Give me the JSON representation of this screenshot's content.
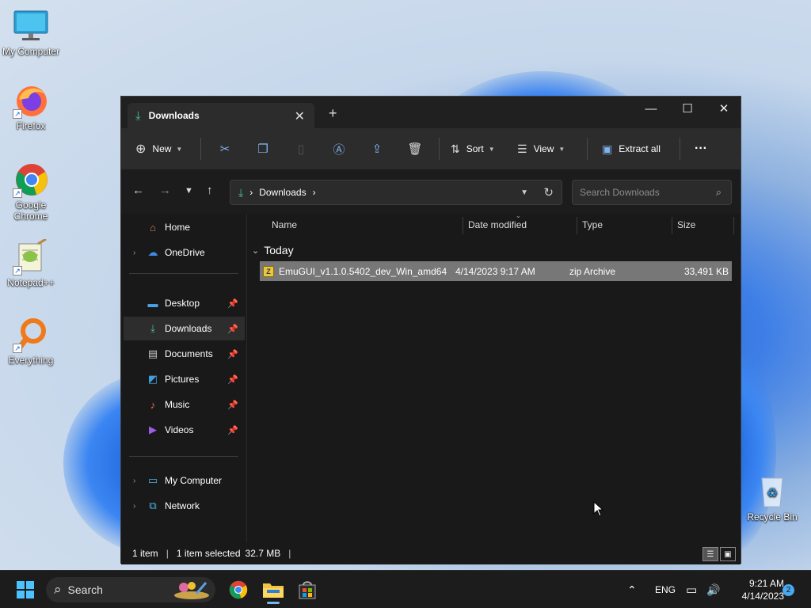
{
  "desktop": {
    "icons": [
      {
        "label": "My Computer"
      },
      {
        "label": "Firefox"
      },
      {
        "label": "Google Chrome"
      },
      {
        "label": "Notepad++"
      },
      {
        "label": "Everything"
      },
      {
        "label": "Recycle Bin"
      }
    ]
  },
  "window": {
    "tab_title": "Downloads",
    "tab_close": "✕",
    "new_tab": "+",
    "controls": {
      "minimize": "—",
      "maximize": "☐",
      "close": "✕"
    },
    "toolbar": {
      "new_label": "New",
      "sort_label": "Sort",
      "view_label": "View",
      "extract_label": "Extract all",
      "more_label": "···"
    },
    "address": {
      "crumb": "Downloads",
      "sep": "›"
    },
    "search": {
      "placeholder": "Search Downloads"
    },
    "sidebar": {
      "home": "Home",
      "onedrive": "OneDrive",
      "desktop": "Desktop",
      "downloads": "Downloads",
      "documents": "Documents",
      "pictures": "Pictures",
      "music": "Music",
      "videos": "Videos",
      "mycomputer": "My Computer",
      "network": "Network"
    },
    "columns": {
      "name": "Name",
      "date": "Date modified",
      "type": "Type",
      "size": "Size"
    },
    "group": "Today",
    "files": [
      {
        "name": "EmuGUI_v1.1.0.5402_dev_Win_amd64",
        "date": "4/14/2023 9:17 AM",
        "type": "zip Archive",
        "size": "33,491 KB"
      }
    ],
    "status": {
      "items": "1 item",
      "selected": "1 item selected",
      "size": "32.7 MB"
    }
  },
  "taskbar": {
    "search_label": "Search",
    "language": "ENG",
    "time": "9:21 AM",
    "date": "4/14/2023",
    "notifications": "2"
  },
  "colors": {
    "accent": "#76b9ed",
    "selection": "#777777",
    "window_bg": "#191919"
  }
}
